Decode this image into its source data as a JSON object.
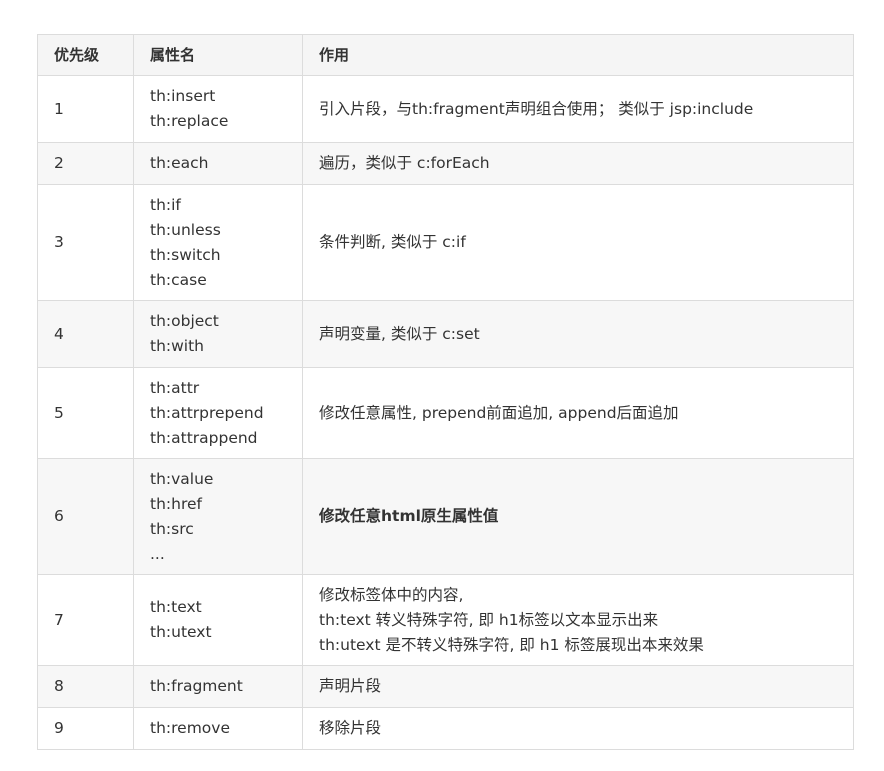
{
  "table": {
    "headers": [
      "优先级",
      "属性名",
      "作用"
    ],
    "rows": [
      {
        "priority": "1",
        "attrs": [
          "th:insert",
          "th:replace"
        ],
        "effect": [
          "引入片段，与th:fragment声明组合使用； 类似于 jsp:include"
        ]
      },
      {
        "priority": "2",
        "attrs": [
          "th:each"
        ],
        "effect": [
          "遍历，类似于 c:forEach"
        ]
      },
      {
        "priority": "3",
        "attrs": [
          "th:if",
          "th:unless",
          "th:switch",
          "th:case"
        ],
        "effect": [
          "条件判断, 类似于 c:if"
        ]
      },
      {
        "priority": "4",
        "attrs": [
          "th:object",
          "th:with"
        ],
        "effect": [
          "声明变量, 类似于 c:set"
        ]
      },
      {
        "priority": "5",
        "attrs": [
          "th:attr",
          "th:attrprepend",
          "th:attrappend"
        ],
        "effect": [
          "修改任意属性, prepend前面追加, append后面追加"
        ]
      },
      {
        "priority": "6",
        "attrs": [
          "th:value",
          "th:href",
          "th:src",
          "..."
        ],
        "effect": [
          "修改任意html原生属性值"
        ]
      },
      {
        "priority": "7",
        "attrs": [
          "th:text",
          "th:utext"
        ],
        "effect": [
          "修改标签体中的内容,",
          "th:text 转义特殊字符, 即 h1标签以文本显示出来",
          "th:utext 是不转义特殊字符, 即 h1 标签展现出本来效果"
        ]
      },
      {
        "priority": "8",
        "attrs": [
          "th:fragment"
        ],
        "effect": [
          "声明片段"
        ]
      },
      {
        "priority": "9",
        "attrs": [
          "th:remove"
        ],
        "effect": [
          "移除片段"
        ]
      }
    ]
  }
}
